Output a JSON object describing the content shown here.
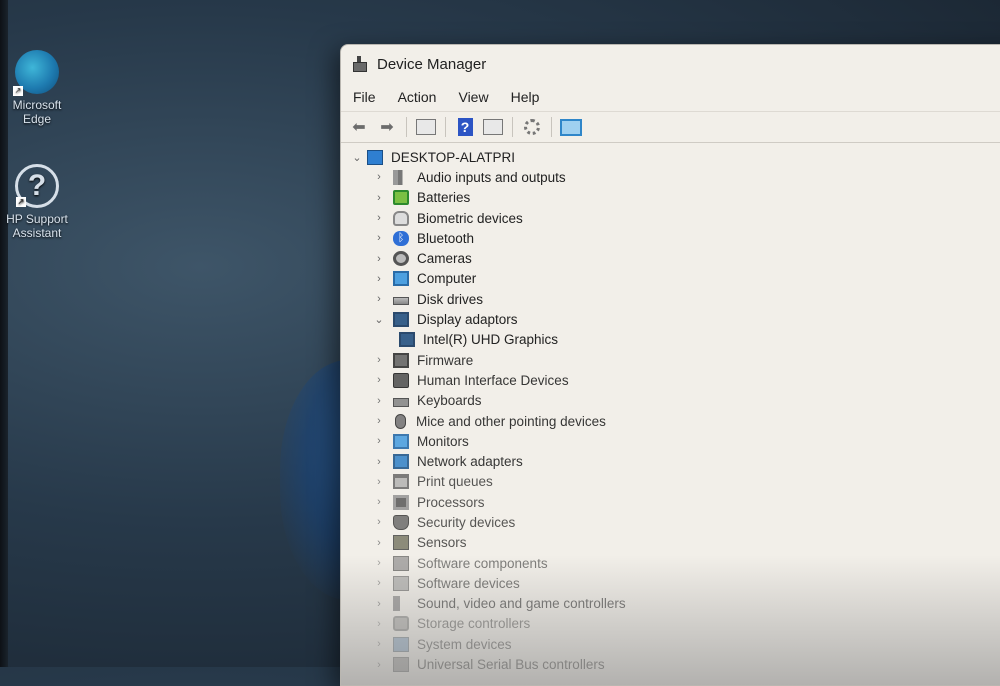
{
  "desktop": {
    "icons": [
      {
        "label": "Microsoft Edge",
        "icon": "edge-icon"
      },
      {
        "label": "HP Support Assistant",
        "icon": "help-icon"
      }
    ]
  },
  "window": {
    "title": "Device Manager",
    "menu": [
      "File",
      "Action",
      "View",
      "Help"
    ],
    "toolbar": [
      "back-arrow-icon",
      "forward-arrow-icon",
      "properties-icon",
      "help-icon",
      "view-icon",
      "update-driver-icon",
      "scan-hardware-icon"
    ]
  },
  "tree": {
    "root": {
      "label": "DESKTOP-ALATPRI",
      "expanded": true
    },
    "categories": [
      {
        "label": "Audio inputs and outputs",
        "expanded": false,
        "icon": "speaker-icon"
      },
      {
        "label": "Batteries",
        "expanded": false,
        "icon": "battery-icon"
      },
      {
        "label": "Biometric devices",
        "expanded": false,
        "icon": "fingerprint-icon"
      },
      {
        "label": "Bluetooth",
        "expanded": false,
        "icon": "bluetooth-icon"
      },
      {
        "label": "Cameras",
        "expanded": false,
        "icon": "camera-icon"
      },
      {
        "label": "Computer",
        "expanded": false,
        "icon": "monitor-icon"
      },
      {
        "label": "Disk drives",
        "expanded": false,
        "icon": "disk-icon"
      },
      {
        "label": "Display adaptors",
        "expanded": true,
        "icon": "display-adapter-icon",
        "children": [
          "Intel(R) UHD Graphics"
        ]
      },
      {
        "label": "Firmware",
        "expanded": false,
        "icon": "firmware-icon"
      },
      {
        "label": "Human Interface Devices",
        "expanded": false,
        "icon": "hid-icon"
      },
      {
        "label": "Keyboards",
        "expanded": false,
        "icon": "keyboard-icon"
      },
      {
        "label": "Mice and other pointing devices",
        "expanded": false,
        "icon": "mouse-icon"
      },
      {
        "label": "Monitors",
        "expanded": false,
        "icon": "monitor-icon"
      },
      {
        "label": "Network adapters",
        "expanded": false,
        "icon": "network-icon"
      },
      {
        "label": "Print queues",
        "expanded": false,
        "icon": "printer-icon"
      },
      {
        "label": "Processors",
        "expanded": false,
        "icon": "processor-icon"
      },
      {
        "label": "Security devices",
        "expanded": false,
        "icon": "security-icon"
      },
      {
        "label": "Sensors",
        "expanded": false,
        "icon": "sensor-icon"
      },
      {
        "label": "Software components",
        "expanded": false,
        "icon": "software-component-icon"
      },
      {
        "label": "Software devices",
        "expanded": false,
        "icon": "software-device-icon"
      },
      {
        "label": "Sound, video and game controllers",
        "expanded": false,
        "icon": "sound-icon"
      },
      {
        "label": "Storage controllers",
        "expanded": false,
        "icon": "storage-icon"
      },
      {
        "label": "System devices",
        "expanded": false,
        "icon": "system-icon"
      },
      {
        "label": "Universal Serial Bus controllers",
        "expanded": false,
        "icon": "usb-icon"
      }
    ]
  }
}
